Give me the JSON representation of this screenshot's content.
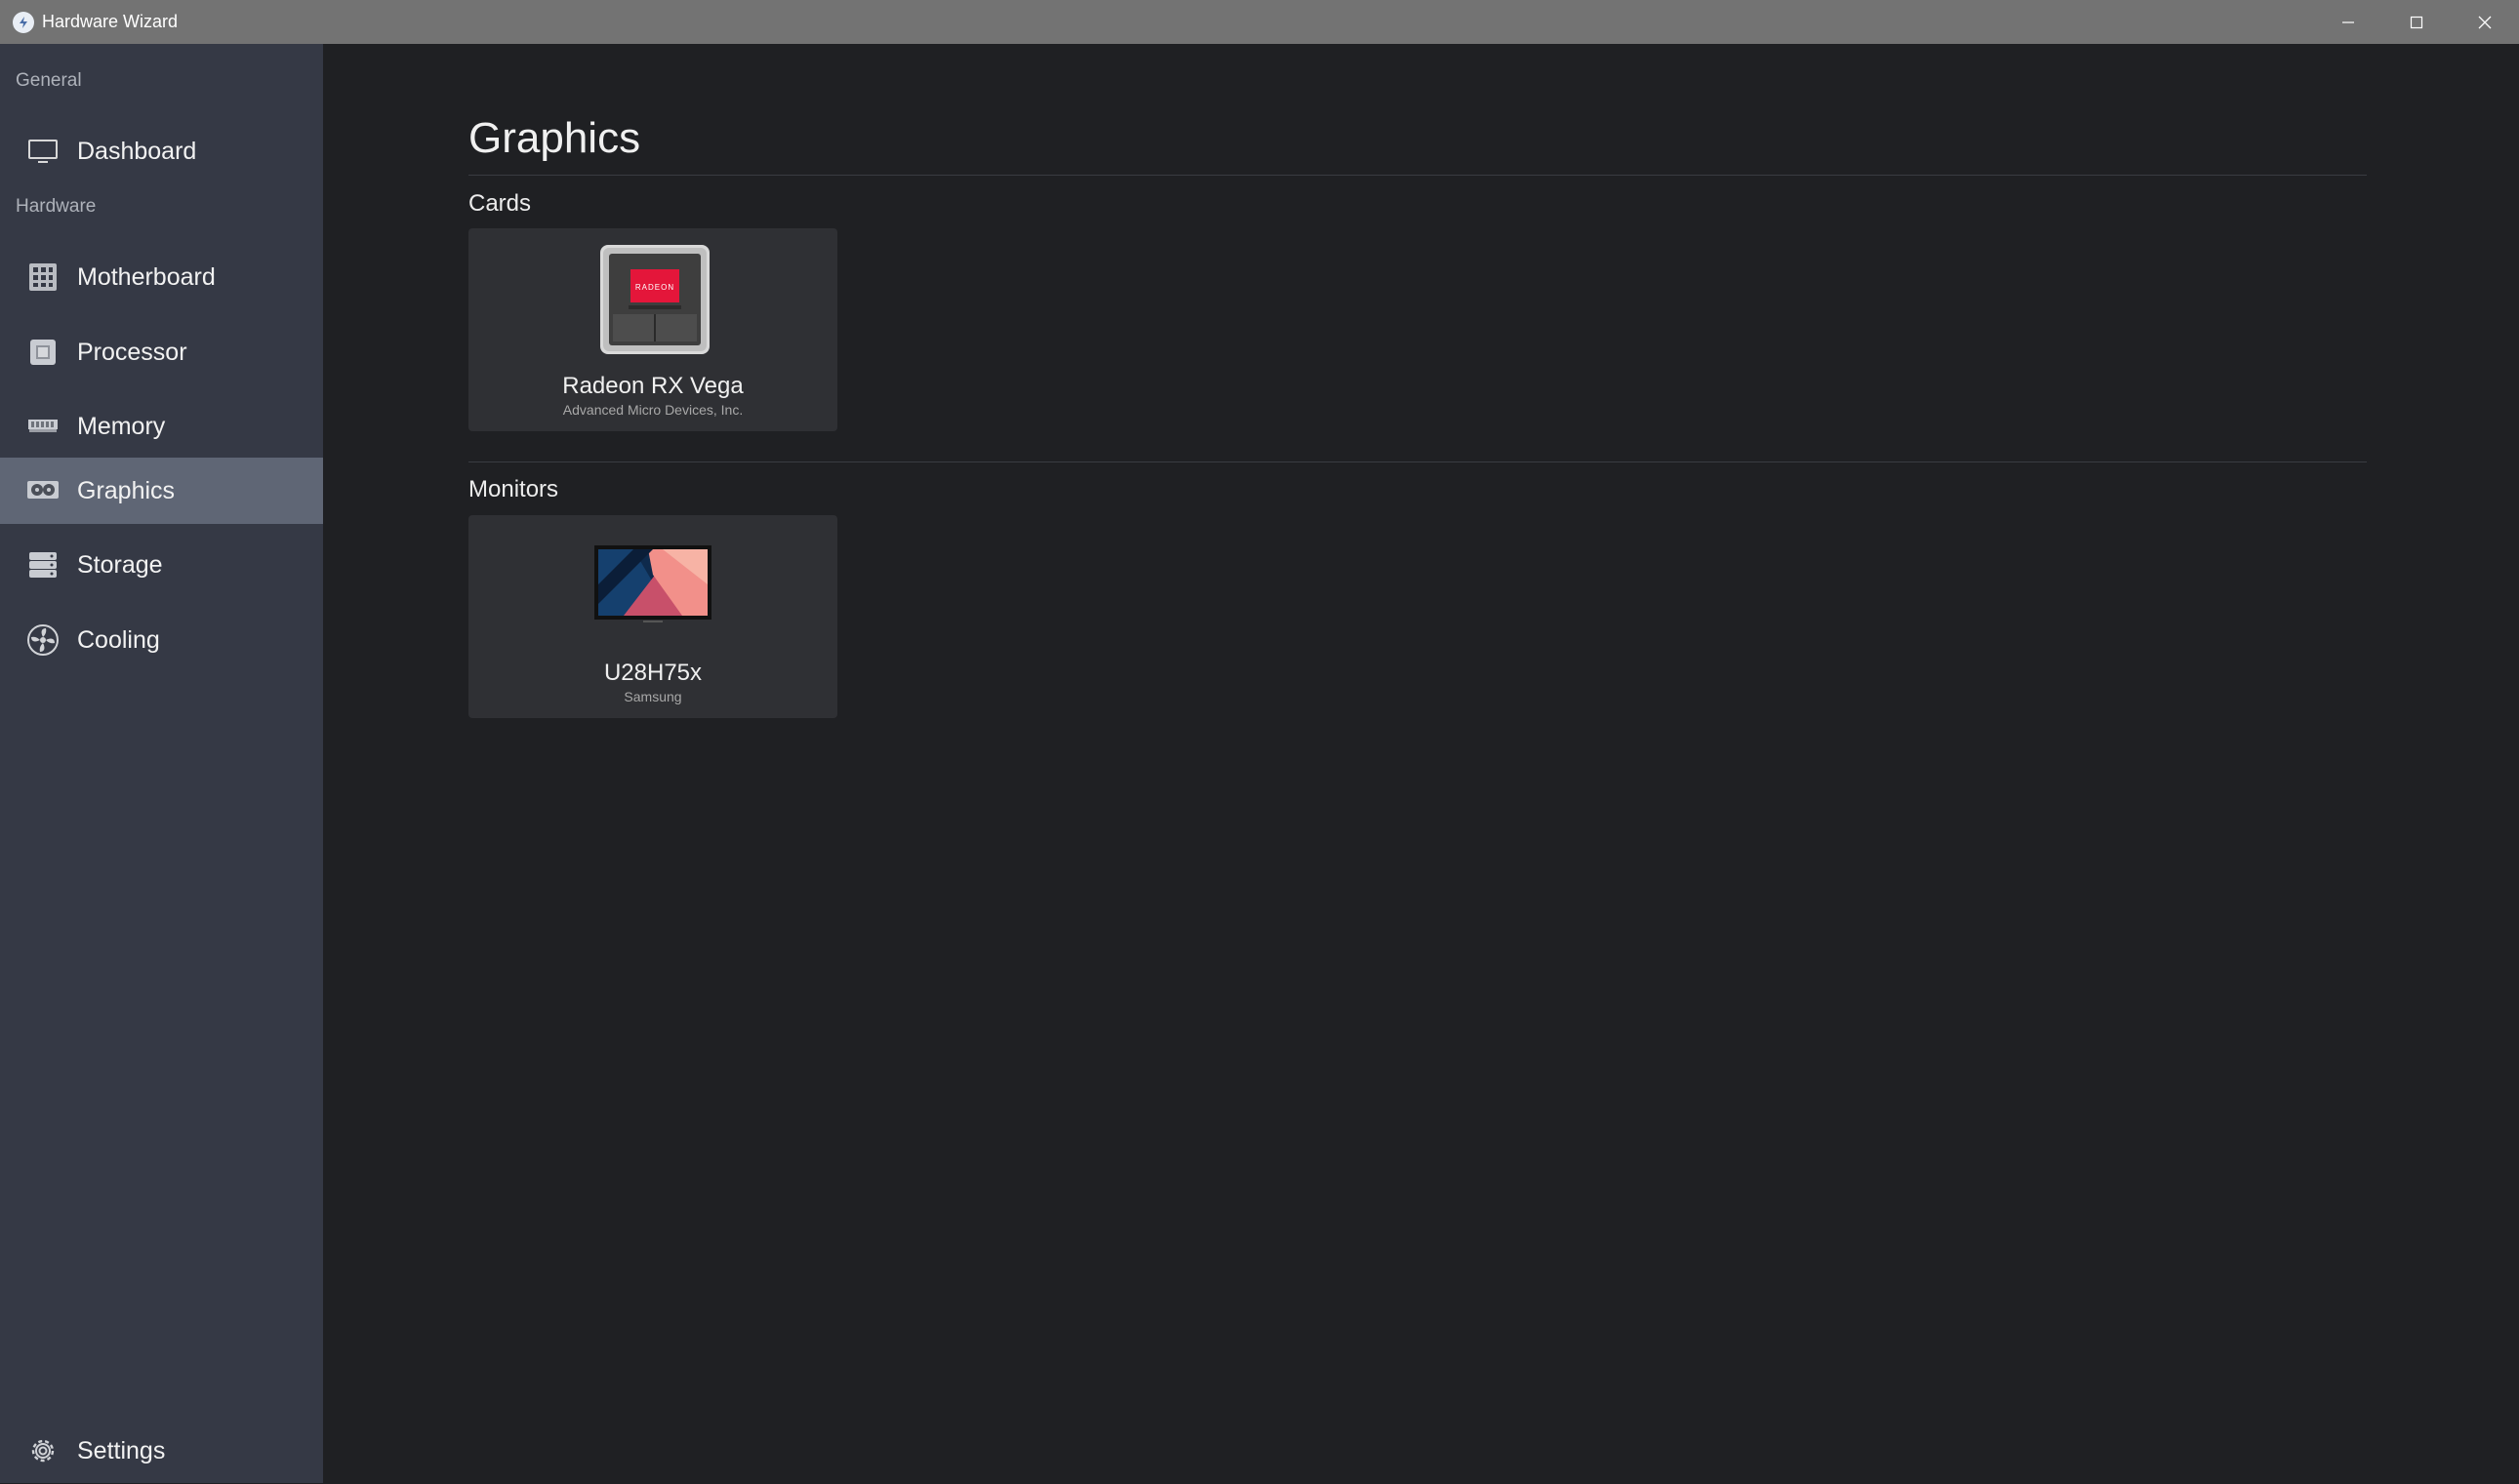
{
  "window": {
    "title": "Hardware Wizard"
  },
  "sidebar": {
    "sections": [
      {
        "label": "General"
      },
      {
        "label": "Hardware"
      }
    ],
    "items": [
      {
        "label": "Dashboard",
        "icon": "monitor-icon"
      },
      {
        "label": "Motherboard",
        "icon": "motherboard-icon"
      },
      {
        "label": "Processor",
        "icon": "processor-icon"
      },
      {
        "label": "Memory",
        "icon": "memory-icon"
      },
      {
        "label": "Graphics",
        "icon": "graphics-card-icon",
        "active": true
      },
      {
        "label": "Storage",
        "icon": "storage-icon"
      },
      {
        "label": "Cooling",
        "icon": "fan-icon"
      }
    ],
    "settings": {
      "label": "Settings",
      "icon": "gear-icon"
    }
  },
  "main": {
    "title": "Graphics",
    "sections": [
      {
        "title": "Cards",
        "devices": [
          {
            "name": "Radeon RX Vega",
            "vendor": "Advanced Micro Devices, Inc.",
            "chip_text": "RADEON",
            "accent": "#e4163a"
          }
        ]
      },
      {
        "title": "Monitors",
        "devices": [
          {
            "name": "U28H75x",
            "vendor": "Samsung"
          }
        ]
      }
    ]
  }
}
